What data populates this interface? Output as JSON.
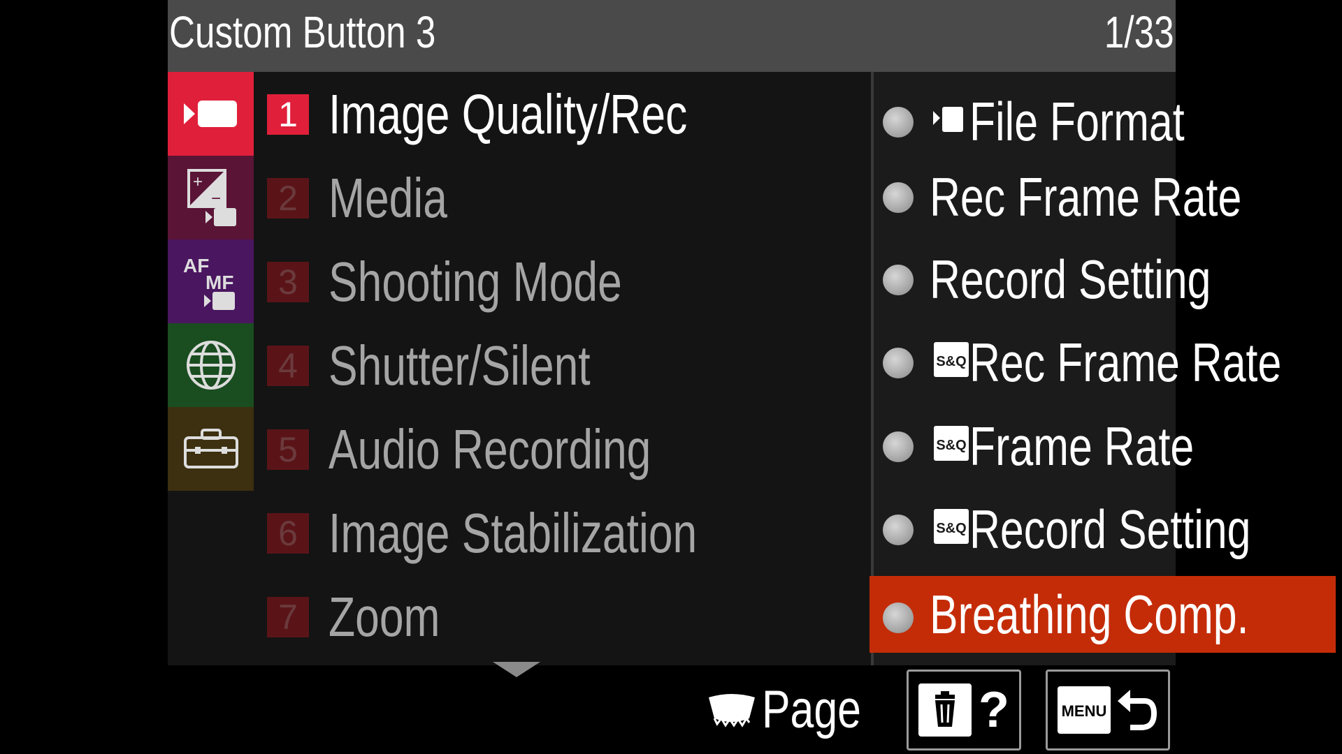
{
  "header": {
    "title": "Custom Button 3",
    "page": "1/33"
  },
  "tabs": [
    {
      "icon": "movie-camera-icon",
      "color": "#e0203a",
      "active": true
    },
    {
      "icon": "exposure-color-icon",
      "color": "#5a1436"
    },
    {
      "icon": "af-mf-icon",
      "color": "#4a1660"
    },
    {
      "icon": "network-globe-icon",
      "color": "#1a4d20"
    },
    {
      "icon": "setup-toolbox-icon",
      "color": "#3d3010"
    }
  ],
  "submenu": {
    "items": [
      {
        "num": "1",
        "label": "Image Quality/Rec"
      },
      {
        "num": "2",
        "label": "Media"
      },
      {
        "num": "3",
        "label": "Shooting Mode"
      },
      {
        "num": "4",
        "label": "Shutter/Silent"
      },
      {
        "num": "5",
        "label": "Audio Recording"
      },
      {
        "num": "6",
        "label": "Image Stabilization"
      },
      {
        "num": "7",
        "label": "Zoom"
      }
    ]
  },
  "options": {
    "items": [
      {
        "label": "File Format",
        "icon": "movie-mode-icon"
      },
      {
        "label": "Rec Frame Rate"
      },
      {
        "label": "Record Setting"
      },
      {
        "label": "Rec Frame Rate",
        "icon": "s-and-q-icon"
      },
      {
        "label": "Frame Rate",
        "icon": "s-and-q-icon"
      },
      {
        "label": "Record Setting",
        "icon": "s-and-q-icon"
      },
      {
        "label": "Breathing Comp.",
        "selected": true
      }
    ],
    "sq_badge": "S&Q"
  },
  "footer": {
    "page_label": "Page",
    "help_label": "?",
    "menu_label": "MENU"
  }
}
